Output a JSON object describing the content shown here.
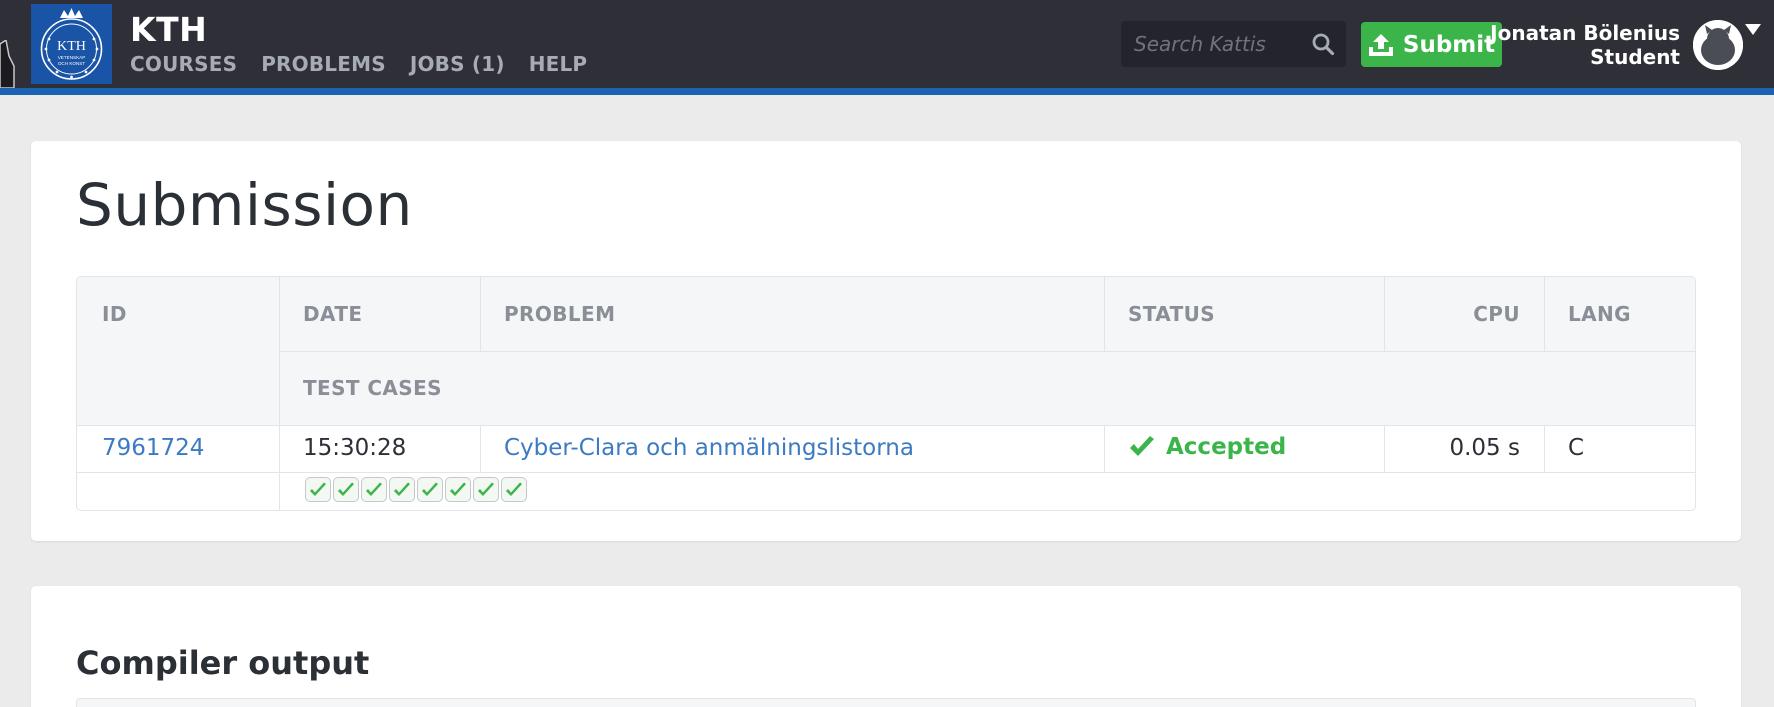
{
  "header": {
    "brand": "KTH",
    "logo_text_top": "KTH",
    "logo_text_ring_1": "VETENSKAP",
    "logo_text_ring_2": "OCH KONST",
    "nav": [
      {
        "label": "COURSES"
      },
      {
        "label": "PROBLEMS"
      },
      {
        "label": "JOBS (1)"
      },
      {
        "label": "HELP"
      }
    ],
    "search_placeholder": "Search Kattis",
    "submit_label": "Submit",
    "user_name": "Jonatan Bölenius",
    "user_role": "Student"
  },
  "page": {
    "title": "Submission"
  },
  "table": {
    "headers": {
      "id": "ID",
      "date": "DATE",
      "problem": "PROBLEM",
      "status": "STATUS",
      "cpu": "CPU",
      "lang": "LANG",
      "test_cases": "TEST CASES"
    },
    "row": {
      "id": "7961724",
      "date": "15:30:28",
      "problem": "Cyber-Clara och anmälningslistorna",
      "status": "Accepted",
      "cpu": "0.05 s",
      "lang": "C",
      "test_cases_passed": 8,
      "test_cases_total": 8
    }
  },
  "compiler": {
    "title": "Compiler output"
  },
  "colors": {
    "header_bg": "#2e2f37",
    "accent_blue": "#1d63b3",
    "accepted_green": "#3bb54a",
    "link_blue": "#3d7ac4"
  },
  "icons": [
    "kth-logo",
    "search-icon",
    "upload-icon",
    "avatar",
    "chevron-down-icon",
    "check-icon"
  ]
}
